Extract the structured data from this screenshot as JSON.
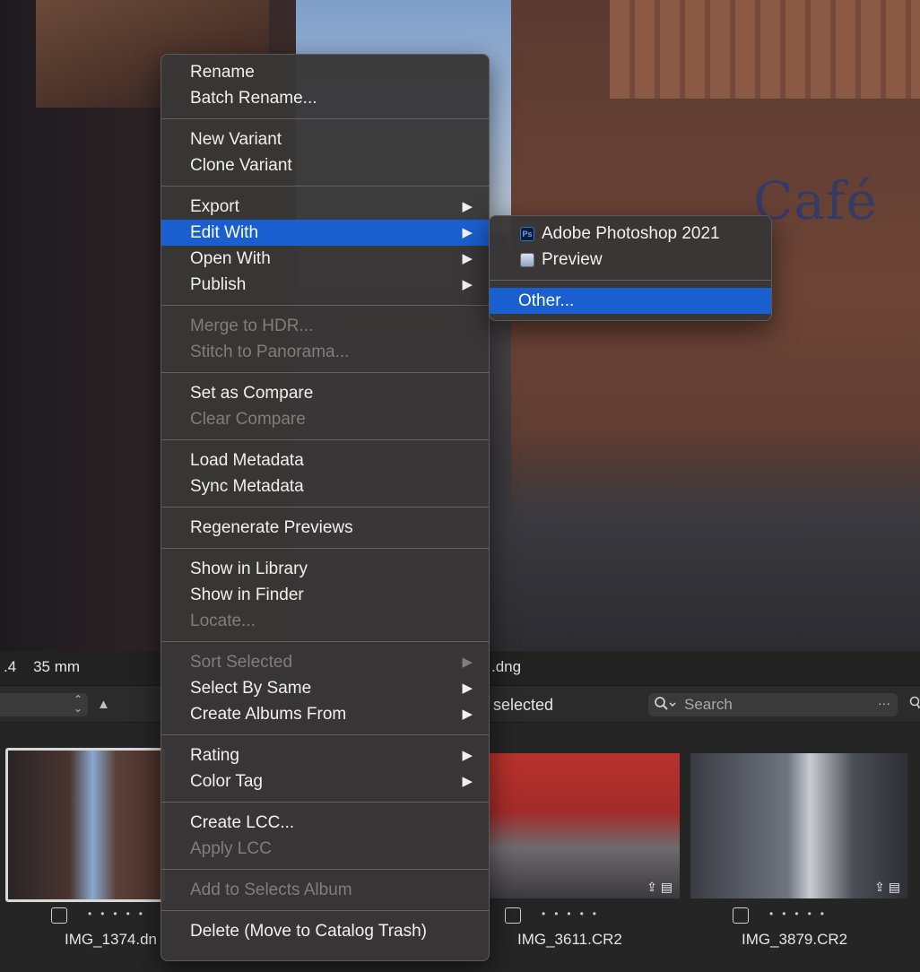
{
  "info_bar": {
    "left_text": ".4    35 mm",
    "right_text": ".dng"
  },
  "toolbar": {
    "selected_text": "selected",
    "search_placeholder": "Search",
    "more_glyph": "···",
    "sort_arrow": "▲"
  },
  "filmstrip": {
    "items": [
      {
        "filename": "IMG_1374.dn"
      },
      {
        "filename": "IMG_3611.CR2"
      },
      {
        "filename": "IMG_3879.CR2"
      }
    ]
  },
  "context_menu": {
    "groups": [
      [
        {
          "label": "Rename",
          "enabled": true
        },
        {
          "label": "Batch Rename...",
          "enabled": true
        }
      ],
      [
        {
          "label": "New Variant",
          "enabled": true
        },
        {
          "label": "Clone Variant",
          "enabled": true
        }
      ],
      [
        {
          "label": "Export",
          "enabled": true,
          "submenu": true
        },
        {
          "label": "Edit With",
          "enabled": true,
          "submenu": true,
          "highlighted": true
        },
        {
          "label": "Open With",
          "enabled": true,
          "submenu": true
        },
        {
          "label": "Publish",
          "enabled": true,
          "submenu": true
        }
      ],
      [
        {
          "label": "Merge to HDR...",
          "enabled": false
        },
        {
          "label": "Stitch to Panorama...",
          "enabled": false
        }
      ],
      [
        {
          "label": "Set as Compare",
          "enabled": true
        },
        {
          "label": "Clear Compare",
          "enabled": false
        }
      ],
      [
        {
          "label": "Load Metadata",
          "enabled": true
        },
        {
          "label": "Sync Metadata",
          "enabled": true
        }
      ],
      [
        {
          "label": "Regenerate Previews",
          "enabled": true
        }
      ],
      [
        {
          "label": "Show in Library",
          "enabled": true
        },
        {
          "label": "Show in Finder",
          "enabled": true
        },
        {
          "label": "Locate...",
          "enabled": false
        }
      ],
      [
        {
          "label": "Sort Selected",
          "enabled": false,
          "submenu": true
        },
        {
          "label": "Select By Same",
          "enabled": true,
          "submenu": true
        },
        {
          "label": "Create Albums From",
          "enabled": true,
          "submenu": true
        }
      ],
      [
        {
          "label": "Rating",
          "enabled": true,
          "submenu": true
        },
        {
          "label": "Color Tag",
          "enabled": true,
          "submenu": true
        }
      ],
      [
        {
          "label": "Create LCC...",
          "enabled": true
        },
        {
          "label": "Apply LCC",
          "enabled": false
        }
      ],
      [
        {
          "label": "Add to Selects Album",
          "enabled": false
        }
      ],
      [
        {
          "label": "Delete (Move to Catalog Trash)",
          "enabled": true
        }
      ]
    ]
  },
  "submenu": {
    "apps": [
      {
        "label": "Adobe Photoshop 2021",
        "icon": "photoshop-icon",
        "icon_text": "Ps"
      },
      {
        "label": "Preview",
        "icon": "preview-icon"
      }
    ],
    "other": {
      "label": "Other...",
      "highlighted": true
    }
  },
  "viewer": {
    "sign_text": "Café"
  },
  "colors": {
    "highlight": "#1a5fd0",
    "menu_bg": "#383636",
    "disabled_text": "#7e7e7e"
  }
}
